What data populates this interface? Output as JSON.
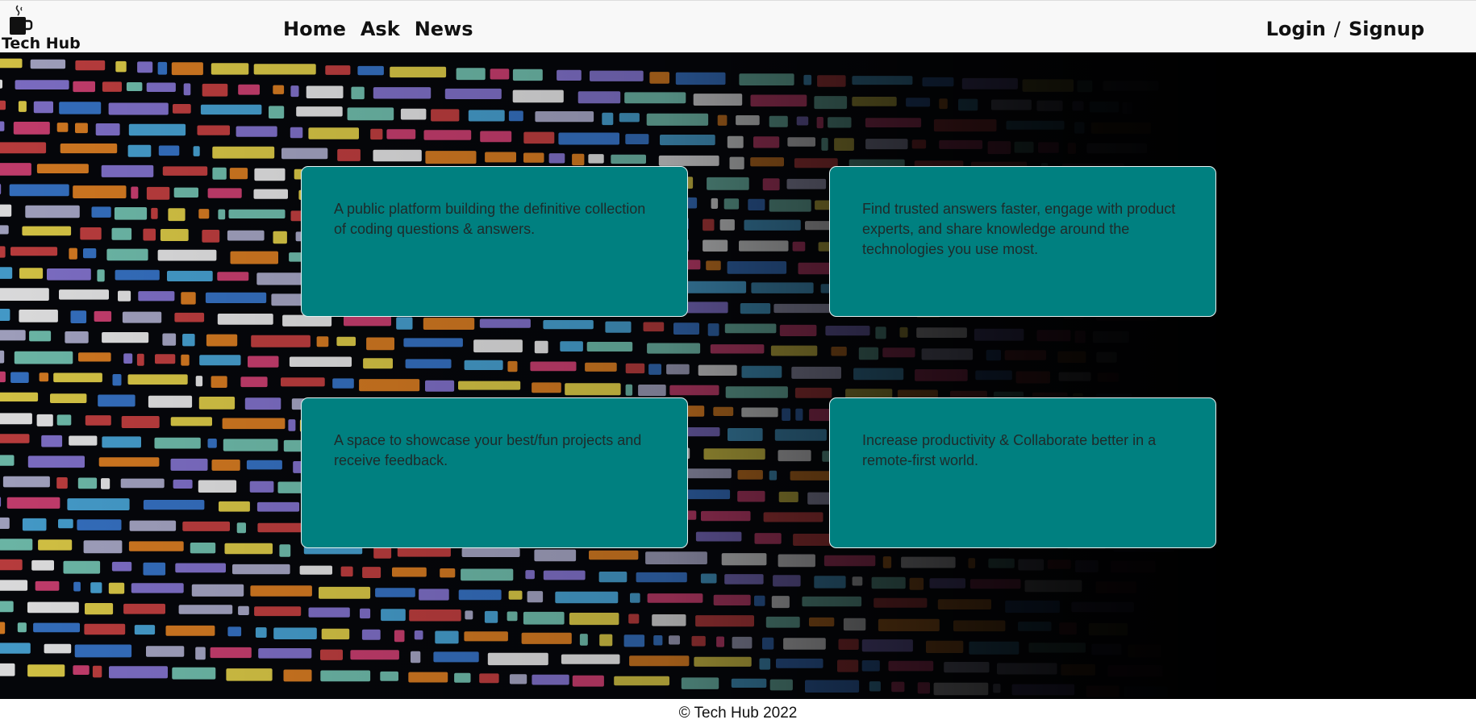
{
  "brand": {
    "name": "Tech Hub",
    "icon": "coffee-mug-icon"
  },
  "nav": {
    "items": [
      {
        "label": "Home"
      },
      {
        "label": "Ask"
      },
      {
        "label": "News"
      }
    ]
  },
  "auth": {
    "login_label": "Login",
    "separator": "/",
    "signup_label": "Signup"
  },
  "cards": [
    {
      "text": "A public platform building the definitive collection of coding questions & answers."
    },
    {
      "text": "Find trusted answers faster, engage with product experts, and share knowledge around the technologies you use most."
    },
    {
      "text": "A space to showcase your best/fun projects and receive feedback."
    },
    {
      "text": "Increase productivity & Collaborate better in a remote-first world."
    }
  ],
  "footer": {
    "text": "© Tech Hub 2022"
  },
  "colors": {
    "card_bg": "#008080",
    "header_bg": "#f8f8f8",
    "hero_bg": "#000000"
  }
}
